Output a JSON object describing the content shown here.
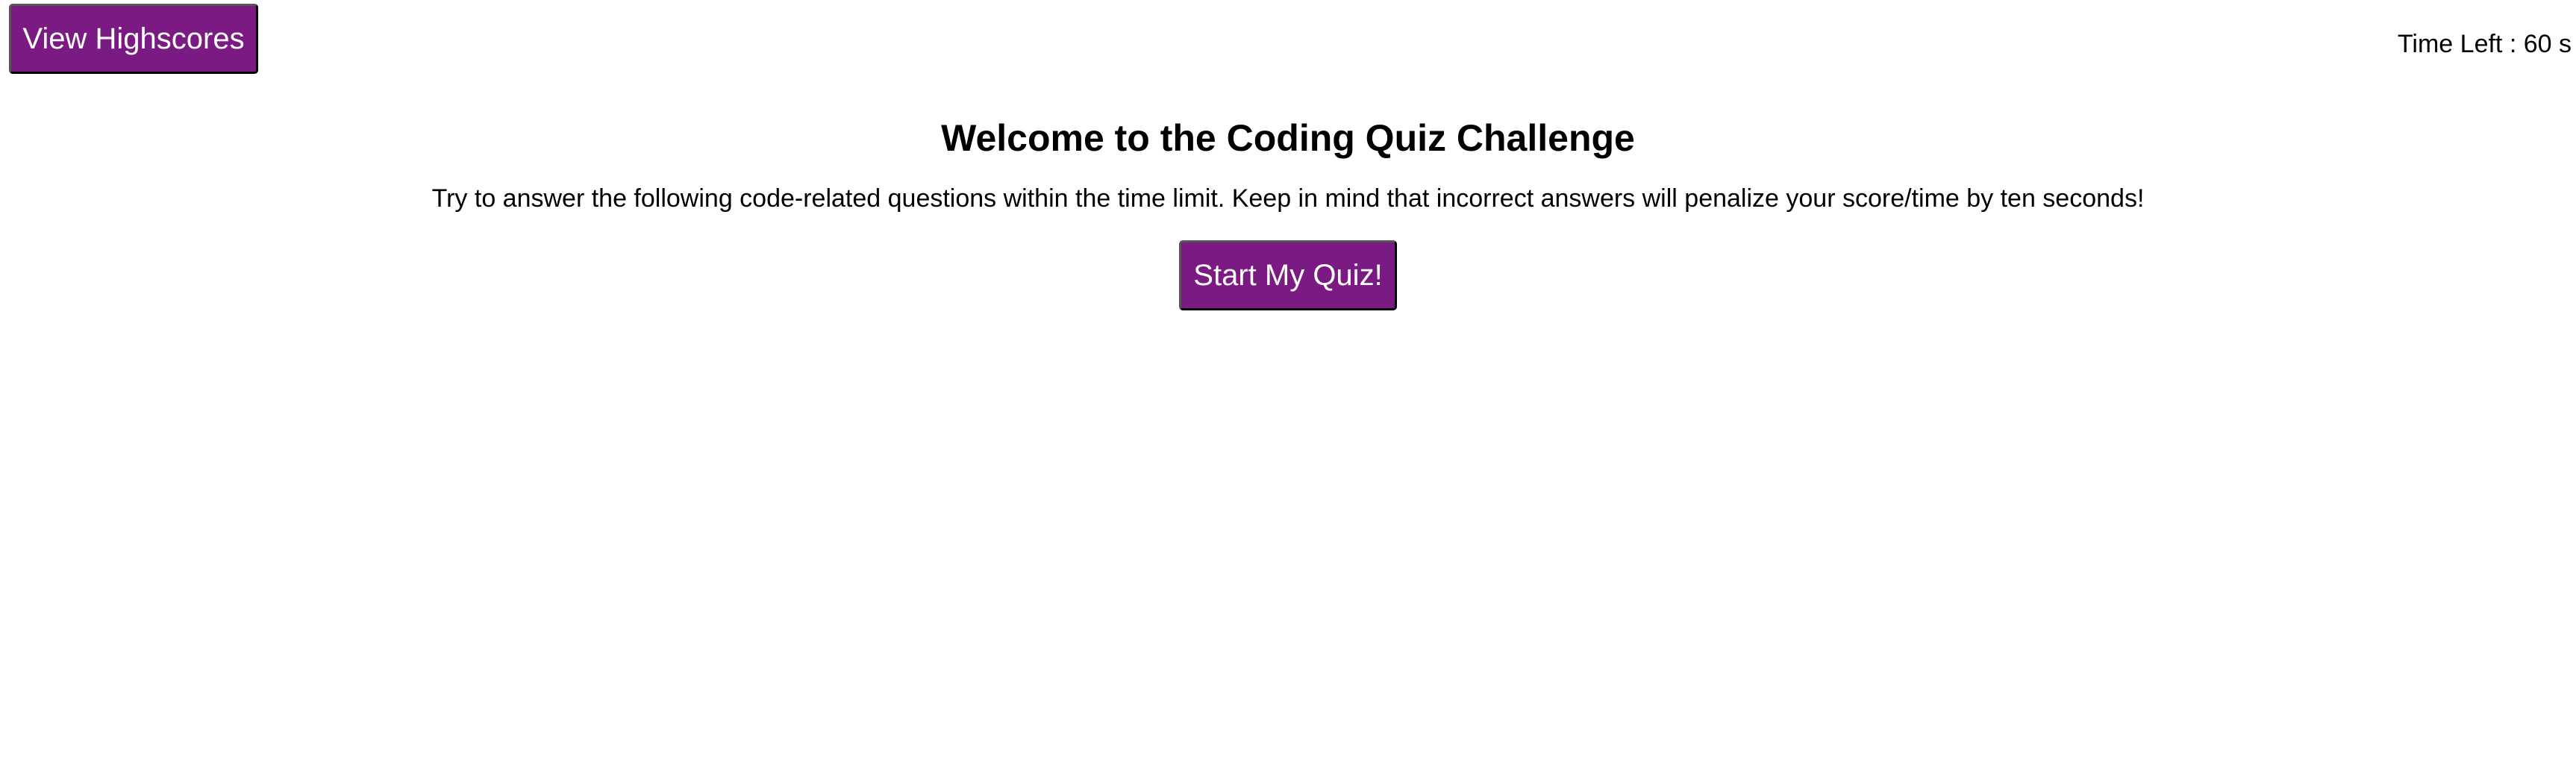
{
  "header": {
    "highscores_label": "View Highscores",
    "timer": {
      "label": "Time Left : ",
      "value": "60",
      "unit": " s"
    }
  },
  "welcome": {
    "title": "Welcome to the Coding Quiz Challenge",
    "instructions": "Try to answer the following code-related questions within the time limit. Keep in mind that incorrect answers will penalize your score/time by ten seconds!",
    "start_label": "Start My Quiz!"
  },
  "colors": {
    "button_background": "#7a1a82",
    "button_text": "#ffffff",
    "page_background": "#ffffff",
    "text": "#000000"
  }
}
